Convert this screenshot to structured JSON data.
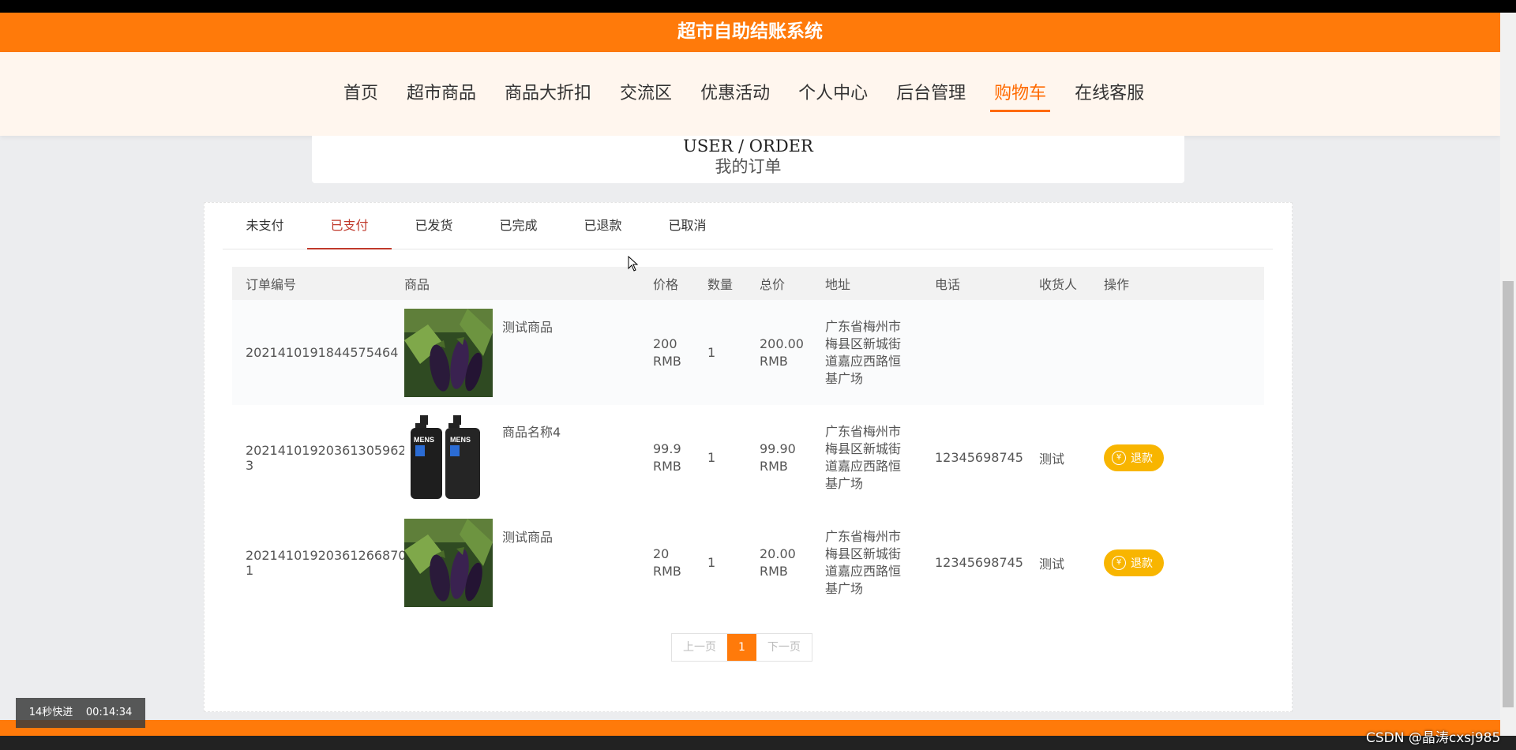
{
  "app": {
    "title": "超市自助结账系统"
  },
  "nav": {
    "items": [
      {
        "label": "首页"
      },
      {
        "label": "超市商品"
      },
      {
        "label": "商品大折扣"
      },
      {
        "label": "交流区"
      },
      {
        "label": "优惠活动"
      },
      {
        "label": "个人中心"
      },
      {
        "label": "后台管理"
      },
      {
        "label": "购物车",
        "active": true
      },
      {
        "label": "在线客服"
      }
    ]
  },
  "page": {
    "title_en": "USER / ORDER",
    "title_zh": "我的订单"
  },
  "tabs": [
    {
      "label": "未支付"
    },
    {
      "label": "已支付",
      "active": true
    },
    {
      "label": "已发货"
    },
    {
      "label": "已完成"
    },
    {
      "label": "已退款"
    },
    {
      "label": "已取消"
    }
  ],
  "table": {
    "headers": [
      "订单编号",
      "商品",
      "价格",
      "数量",
      "总价",
      "地址",
      "电话",
      "收货人",
      "操作"
    ],
    "rows": [
      {
        "order_no": "2021410191844575464",
        "goods": "测试商品",
        "image": "eggplant",
        "price": "200",
        "price_unit": "RMB",
        "qty": "1",
        "total": "200.00",
        "total_unit": "RMB",
        "address": "广东省梅州市梅县区新城街道嘉应西路恒基广场",
        "phone": "",
        "receiver": "",
        "action": ""
      },
      {
        "order_no": "20214101920361305962​3",
        "goods": "商品名称4",
        "image": "mens-bottles",
        "price": "99.9",
        "price_unit": "RMB",
        "qty": "1",
        "total": "99.90",
        "total_unit": "RMB",
        "address": "广东省梅州市梅县区新城街道嘉应西路恒基广场",
        "phone": "12345698745",
        "receiver": "测试",
        "action": "退款"
      },
      {
        "order_no": "20214101920361266870​1",
        "goods": "测试商品",
        "image": "eggplant",
        "price": "20",
        "price_unit": "RMB",
        "qty": "1",
        "total": "20.00",
        "total_unit": "RMB",
        "address": "广东省梅州市梅县区新城街道嘉应西路恒基广场",
        "phone": "12345698745",
        "receiver": "测试",
        "action": "退款"
      }
    ]
  },
  "pagination": {
    "prev": "上一页",
    "current": "1",
    "next": "下一页"
  },
  "overlay": {
    "text": "14秒快进",
    "time": "00:14:34"
  },
  "watermark": "CSDN @晶涛cxsj985",
  "colors": {
    "primary": "#ff7a0a",
    "active_tab": "#c0392b",
    "refund": "#f8b500"
  }
}
